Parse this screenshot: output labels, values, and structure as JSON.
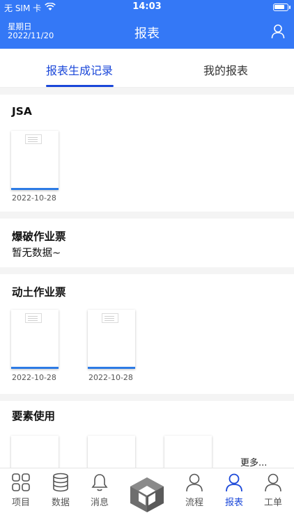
{
  "status_bar": {
    "carrier": "无 SIM 卡",
    "time": "14:03"
  },
  "header": {
    "weekday": "星期日",
    "date": "2022/11/20",
    "title": "报表"
  },
  "tabs": [
    {
      "label": "报表生成记录",
      "active": true
    },
    {
      "label": "我的报表",
      "active": false
    }
  ],
  "sections": [
    {
      "title": "JSA",
      "items": [
        {
          "date": "2022-10-28"
        }
      ]
    },
    {
      "title": "爆破作业票",
      "empty_text": "暂无数据~"
    },
    {
      "title": "动土作业票",
      "items": [
        {
          "date": "2022-10-28"
        },
        {
          "date": "2022-10-28"
        }
      ]
    },
    {
      "title": "要素使用",
      "more": "更多..."
    }
  ],
  "tabbar": [
    {
      "label": "项目",
      "icon": "grid-icon"
    },
    {
      "label": "数据",
      "icon": "database-icon"
    },
    {
      "label": "消息",
      "icon": "bell-icon"
    },
    {
      "label": "",
      "icon": "logo-icon"
    },
    {
      "label": "流程",
      "icon": "person-icon"
    },
    {
      "label": "报表",
      "icon": "person-icon",
      "active": true
    },
    {
      "label": "工单",
      "icon": "person-icon"
    }
  ],
  "colors": {
    "primary": "#3478f6",
    "accent": "#1a47d9",
    "bar": "#2d7be5"
  }
}
